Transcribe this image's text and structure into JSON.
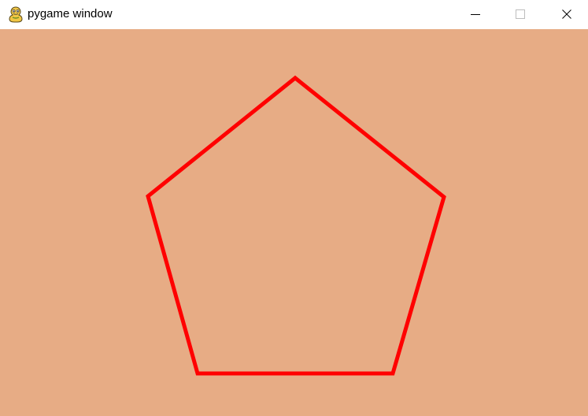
{
  "window": {
    "title": "pygame window",
    "app_icon": "pygame-snake-icon",
    "controls": {
      "minimize_icon": "minimize-icon",
      "maximize_icon": "maximize-icon",
      "close_icon": "close-icon"
    }
  },
  "canvas": {
    "background_color": "#e7ac85",
    "shape": {
      "type": "pentagon-outline",
      "stroke_color": "#ff0000"
    }
  }
}
